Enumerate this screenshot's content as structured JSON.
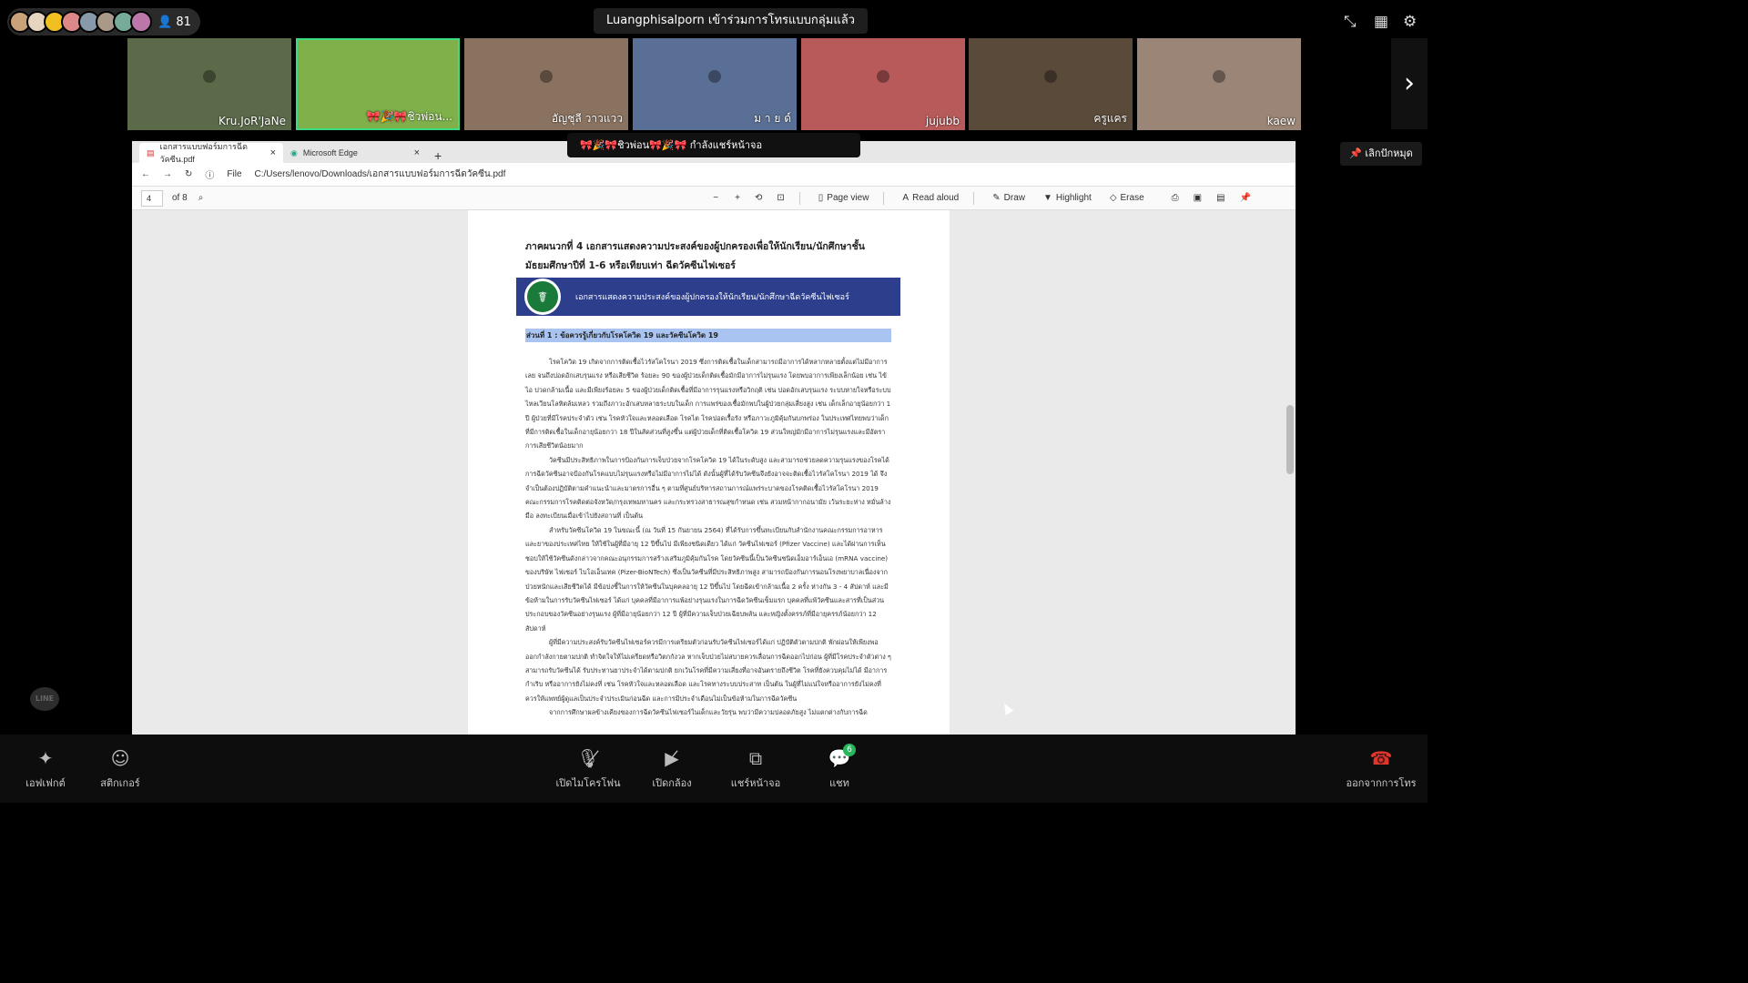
{
  "top": {
    "participant_count": "81",
    "notice": "Luangphisalporn เข้าร่วมการโทรแบบกลุ่มแล้ว"
  },
  "tiles": [
    {
      "name": "Kru.JoR'JaNe",
      "color": "#5b6b4a"
    },
    {
      "name": "🎀🎉🎀ชิวพ่อน...",
      "color": "#7fb04a"
    },
    {
      "name": "อัญชุลี วาวแวว",
      "color": "#8a7260"
    },
    {
      "name": "ม า ย ด์",
      "color": "#5a6f95"
    },
    {
      "name": "jujubb",
      "color": "#b85a5a"
    },
    {
      "name": "ครูแคร",
      "color": "#5a4a3a"
    },
    {
      "name": "kaew",
      "color": "#9a8576"
    }
  ],
  "presenter_chip": "🎀🎉🎀ชิวพ่อน🎀🎉🎀 กำลังแชร์หน้าจอ",
  "stop_share": "เลิกปักหมุด",
  "browser": {
    "tab1": "เอกสารแบบฟอร์มการฉีดวัคซีน.pdf",
    "tab2": "Microsoft Edge",
    "file_label": "File",
    "url": "C:/Users/lenovo/Downloads/เอกสารแบบฟอร์มการฉีดวัคซีน.pdf",
    "page": "4",
    "of": "of 8",
    "tools": [
      "Page view",
      "Read aloud",
      "Draw",
      "Highlight",
      "Erase"
    ]
  },
  "doc": {
    "title": "ภาคผนวกที่ 4 เอกสารแสดงความประสงค์ของผู้ปกครองเพื่อให้นักเรียน/นักศึกษาชั้นมัธยมศึกษาปีที่ 1-6 หรือเทียบเท่า ฉีดวัคซีนไฟเซอร์",
    "banner": "เอกสารแสดงความประสงค์ของผู้ปกครองให้นักเรียน/นักศึกษาฉีดวัคซีนไฟเซอร์",
    "section": "ส่วนที่ 1 : ข้อควรรู้เกี่ยวกับโรคโควิด 19 และวัคซีนโควิด 19",
    "paras": [
      "โรคโควิด 19 เกิดจากการติดเชื้อไวรัสโคโรนา 2019 ซึ่งการติดเชื้อในเด็กสามารถมีอาการได้หลากหลายตั้งแต่ไม่มีอาการเลย จนถึงปอดอักเสบรุนแรง หรือเสียชีวิต ร้อยละ 90 ของผู้ป่วยเด็กติดเชื้อมักมีอาการไม่รุนแรง โดยพบอาการเพียงเล็กน้อย เช่น ไข้ ไอ ปวดกล้ามเนื้อ และมีเพียงร้อยละ 5 ของผู้ป่วยเด็กติดเชื้อที่มีอาการรุนแรงหรือวิกฤติ เช่น ปอดอักเสบรุนแรง ระบบหายใจหรือระบบไหลเวียนโลหิตล้มเหลว รวมถึงภาวะอักเสบหลายระบบในเด็ก การแพร่ของเชื้อมักพบในผู้ป่วยกลุ่มเสี่ยงสูง เช่น เด็กเล็กอายุน้อยกว่า 1 ปี ผู้ป่วยที่มีโรคประจำตัว เช่น โรคหัวใจและหลอดเลือด โรคไต โรคปอดเรื้อรัง หรือภาวะภูมิคุ้มกันบกพร่อง ในประเทศไทยพบว่าเด็กที่มีการติดเชื้อในเด็กอายุน้อยกว่า 18 ปีในสัดส่วนที่สูงขึ้น แต่ผู้ป่วยเด็กที่ติดเชื้อโควิด 19 ส่วนใหญ่มักมีอาการไม่รุนแรงและมีอัตราการเสียชีวิตน้อยมาก",
      "วัคซีนมีประสิทธิภาพในการป้องกันการเจ็บป่วยจากโรคโควิด 19 ได้ในระดับสูง และสามารถช่วยลดความรุนแรงของโรคได้ การฉีดวัคซีนอาจป้องกันโรคแบบไม่รุนแรงหรือไม่มีอาการไม่ได้ ดังนั้นผู้ที่ได้รับวัคซีนจึงยังอาจจะติดเชื้อไวรัสโคโรนา 2019 ได้ จึงจำเป็นต้องปฏิบัติตามคำแนะนำและมาตรการอื่น ๆ ตามที่ศูนย์บริหารสถานการณ์แพร่ระบาดของโรคติดเชื้อไวรัสโคโรนา 2019 คณะกรรมการโรคติดต่อจังหวัด/กรุงเทพมหานคร และกระทรวงสาธารณสุขกำหนด เช่น สวมหน้ากากอนามัย เว้นระยะห่าง หมั่นล้างมือ ลงทะเบียนเมื่อเข้าไปยังสถานที่ เป็นต้น",
      "สำหรับวัคซีนโควิด 19 ในขณะนี้ (ณ วันที่ 15 กันยายน 2564) ที่ได้รับการขึ้นทะเบียนกับสำนักงานคณะกรรมการอาหารและยาของประเทศไทย ให้ใช้ในผู้ที่มีอายุ 12 ปีขึ้นไป มีเพียงชนิดเดียว ได้แก่ วัคซีนไฟเซอร์ (Pfizer Vaccine) และได้ผ่านการเห็นชอบให้ใช้วัคซีนดังกล่าวจากคณะอนุกรรมการสร้างเสริมภูมิคุ้มกันโรค โดยวัคซีนนี้เป็นวัคซีนชนิดเอ็มอาร์เอ็นเอ (mRNA vaccine) ของบริษัท ไฟเซอร์ ไบโอเอ็นเทค (Pizer-BioNTech) ซึ่งเป็นวัคซีนที่มีประสิทธิภาพสูง สามารถป้องกันการนอนโรงพยาบาลเนื่องจากป่วยหนักและเสียชีวิตได้ มีข้อบ่งชี้ในการให้วัคซีนในบุคคลอายุ 12 ปีขึ้นไป โดยฉีดเข้ากล้ามเนื้อ 2 ครั้ง ห่างกัน 3 - 4 สัปดาห์ และมีข้อห้ามในการรับวัคซีนไฟเซอร์ ได้แก่ บุคคลที่มีอาการแพ้อย่างรุนแรงในการฉีดวัคซีนเข็มแรก บุคคลที่แพ้วัคซีนและสารที่เป็นส่วนประกอบของวัคซีนอย่างรุนแรง ผู้ที่มีอายุน้อยกว่า 12 ปี ผู้ที่มีความเจ็บป่วยเฉียบพลัน และหญิงตั้งครรภ์ที่มีอายุครรภ์น้อยกว่า 12 สัปดาห์",
      "ผู้ที่มีความประสงค์รับวัคซีนไฟเซอร์ควรมีการเตรียมตัวก่อนรับวัคซีนไฟเซอร์ได้แก่ ปฏิบัติตัวตามปกติ พักผ่อนให้เพียงพอ ออกกำลังกายตามปกติ ทำจิตใจให้ไม่เครียดหรือวิตกกังวล หากเจ็บป่วยไม่สบายควรเลื่อนการฉีดออกไปก่อน ผู้ที่มีโรคประจำตัวต่าง ๆ สามารถรับวัคซีนได้ รับประทานยาประจำได้ตามปกติ ยกเว้นโรคที่มีความเสี่ยงที่อาจอันตรายถึงชีวิต โรคที่ยังควบคุมไม่ได้ มีอาการกำเริบ หรืออาการยังไม่คงที่ เช่น โรคหัวใจและหลอดเลือด และโรคทางระบบประสาท เป็นต้น ในผู้ที่ไม่แน่ใจหรืออาการยังไม่คงที่ ควรให้แพทย์ผู้ดูแลเป็นประจำประเมินก่อนฉีด และการมีประจำเดือนไม่เป็นข้อห้ามในการฉีดวัคซีน",
      "จากการศึกษาผลข้างเคียงของการฉีดวัคซีนไฟเซอร์ในเด็กและวัยรุ่น พบว่ามีความปลอดภัยสูง ไม่แตกต่างกับการฉีด"
    ]
  },
  "line_label": "LINE",
  "bottom": {
    "effects": "เอฟเฟกต์",
    "stickers": "สติกเกอร์",
    "mic": "เปิดไมโครโฟน",
    "camera": "เปิดกล้อง",
    "share": "แชร์หน้าจอ",
    "chat": "แชท",
    "chat_badge": "6",
    "leave": "ออกจากการโทร"
  }
}
